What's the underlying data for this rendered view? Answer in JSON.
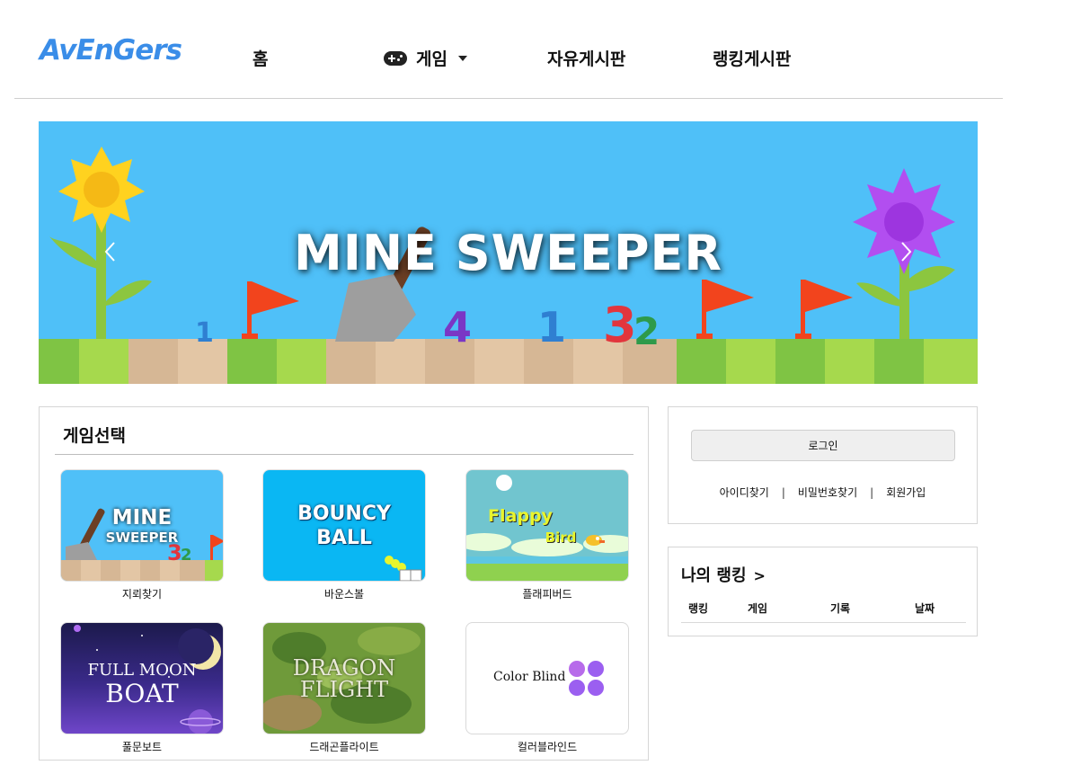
{
  "header": {
    "logo": "AvEnGers",
    "nav": {
      "home": "홈",
      "game": "게임",
      "free_board": "자유게시판",
      "ranking_board": "랭킹게시판"
    }
  },
  "carousel": {
    "title": "MINE SWEEPER"
  },
  "game_select": {
    "title": "게임선택",
    "games": [
      {
        "label": "지뢰찾기",
        "thumb_line1": "MINE",
        "thumb_line2": "SWEEPER"
      },
      {
        "label": "바운스볼",
        "thumb_line1": "BOUNCY",
        "thumb_line2": "BALL"
      },
      {
        "label": "플래피버드",
        "thumb_line1": "Flappy",
        "thumb_line2": "Bird"
      },
      {
        "label": "풀문보트",
        "thumb_line1": "FULL MOON",
        "thumb_line2": "BOAT"
      },
      {
        "label": "드래곤플라이트",
        "thumb_line1": "DRAGON",
        "thumb_line2": "FLIGHT"
      },
      {
        "label": "컬러블라인드",
        "thumb_line1": "Color Blind"
      }
    ]
  },
  "login": {
    "button": "로그인",
    "find_id": "아이디찾기",
    "find_pw": "비밀번호찾기",
    "signup": "회원가입",
    "separator": "|"
  },
  "ranking": {
    "title": "나의 랭킹",
    "arrow": ">",
    "columns": [
      "랭킹",
      "게임",
      "기록",
      "날짜"
    ]
  },
  "colors": {
    "sky": "#4fc0f8",
    "grass_light": "#a6d94d",
    "grass_dark": "#7fc444",
    "sand": "#dcbf9d",
    "flag": "#f2441d",
    "bouncy_bg": "#0ab7f3",
    "violet": "#9b5ff0"
  }
}
